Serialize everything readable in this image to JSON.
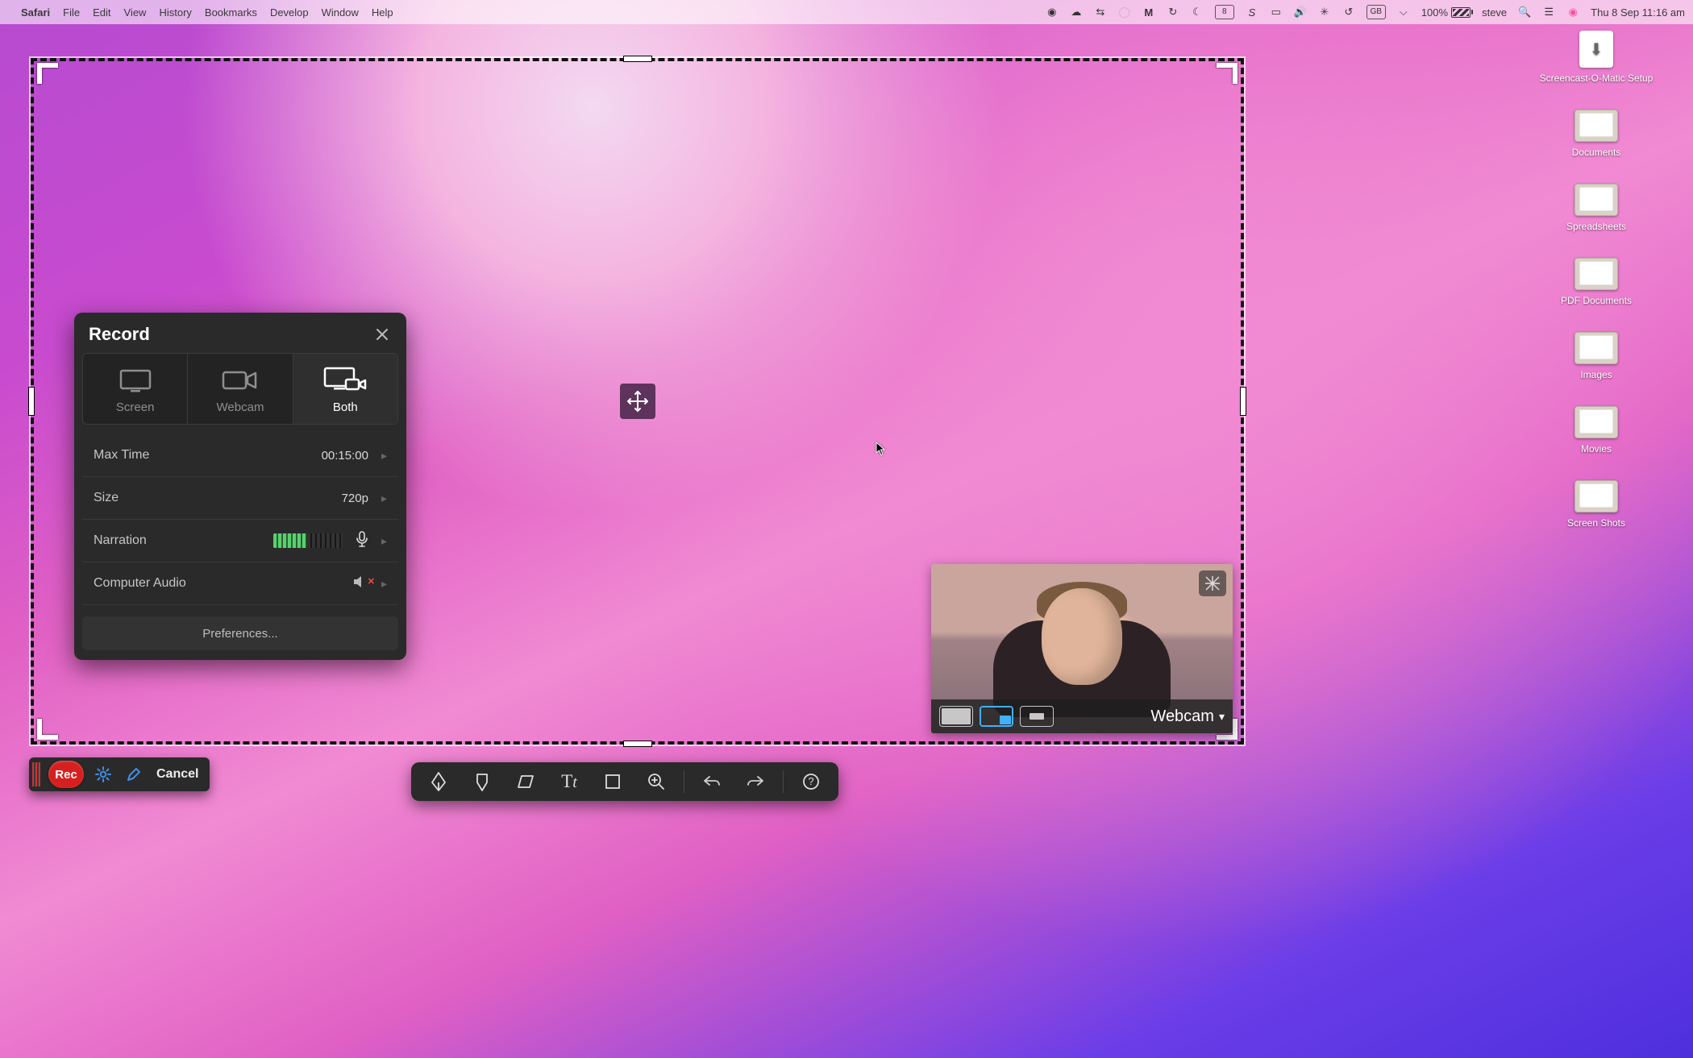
{
  "menubar": {
    "app_name": "Safari",
    "items": [
      "File",
      "Edit",
      "View",
      "History",
      "Bookmarks",
      "Develop",
      "Window",
      "Help"
    ],
    "battery_pct": "100%",
    "keyboard": "GB",
    "date_badge": "8",
    "username": "steve",
    "datetime": "Thu 8 Sep  11:16 am"
  },
  "desk_icons": [
    {
      "kind": "app",
      "label": "Screencast-O-Matic Setup"
    },
    {
      "kind": "folder",
      "label": "Documents"
    },
    {
      "kind": "folder",
      "label": "Spreadsheets"
    },
    {
      "kind": "folder",
      "label": "PDF Documents"
    },
    {
      "kind": "folder",
      "label": "Images"
    },
    {
      "kind": "folder",
      "label": "Movies"
    },
    {
      "kind": "folder",
      "label": "Screen Shots"
    }
  ],
  "record_panel": {
    "title": "Record",
    "modes": [
      {
        "key": "screen",
        "label": "Screen"
      },
      {
        "key": "webcam",
        "label": "Webcam"
      },
      {
        "key": "both",
        "label": "Both",
        "selected": true
      }
    ],
    "rows": {
      "max_time": {
        "label": "Max Time",
        "value": "00:15:00"
      },
      "size": {
        "label": "Size",
        "value": "720p"
      },
      "narration": {
        "label": "Narration"
      },
      "comp_audio": {
        "label": "Computer Audio",
        "enabled": false
      }
    },
    "prefs_label": "Preferences..."
  },
  "control_bar": {
    "rec_label": "Rec",
    "cancel_label": "Cancel"
  },
  "webcam_preview": {
    "label": "Webcam",
    "pip_options": [
      "full",
      "pip",
      "hidden"
    ],
    "pip_selected": "pip"
  }
}
